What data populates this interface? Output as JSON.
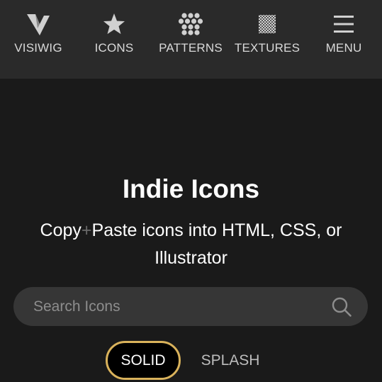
{
  "nav": {
    "items": [
      {
        "label": "VISIWIG",
        "icon": "visiwig-logo-icon"
      },
      {
        "label": "ICONS",
        "icon": "star-icon"
      },
      {
        "label": "PATTERNS",
        "icon": "dots-pattern-icon"
      },
      {
        "label": "TEXTURES",
        "icon": "checker-texture-icon"
      },
      {
        "label": "MENU",
        "icon": "hamburger-menu-icon"
      }
    ]
  },
  "hero": {
    "title": "Indie Icons",
    "subtitle_before": "Copy",
    "subtitle_plus": "+",
    "subtitle_after": "Paste icons into HTML, CSS, or Illustrator"
  },
  "search": {
    "placeholder": "Search Icons",
    "value": "",
    "icon": "search-icon"
  },
  "tabs": [
    {
      "label": "SOLID",
      "active": true
    },
    {
      "label": "SPLASH",
      "active": false
    }
  ],
  "colors": {
    "background": "#1a1a1a",
    "nav_background": "#2a2a2a",
    "search_background": "#363636",
    "active_tab_border": "#d9b25b"
  }
}
